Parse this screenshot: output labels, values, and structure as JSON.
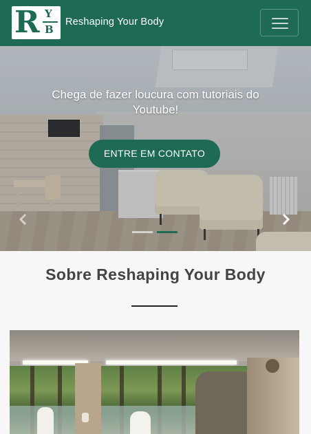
{
  "navbar": {
    "brand": "Reshaping Your Body",
    "logo": {
      "letter_main": "R",
      "letter_top": "Y",
      "letter_bottom": "B"
    },
    "toggler_icon": "hamburger-menu-icon",
    "color": "#1e6a54"
  },
  "hero": {
    "caption": "Chega de fazer loucura com tutoriais do Youtube!",
    "cta_label": "ENTRE EM CONTATO",
    "prev_icon": "chevron-left-icon",
    "next_icon": "chevron-right-icon",
    "indicators": {
      "count": 2,
      "active_index": 1
    },
    "accent": "#1e6a54"
  },
  "about": {
    "title": "Sobre Reshaping Your Body"
  }
}
